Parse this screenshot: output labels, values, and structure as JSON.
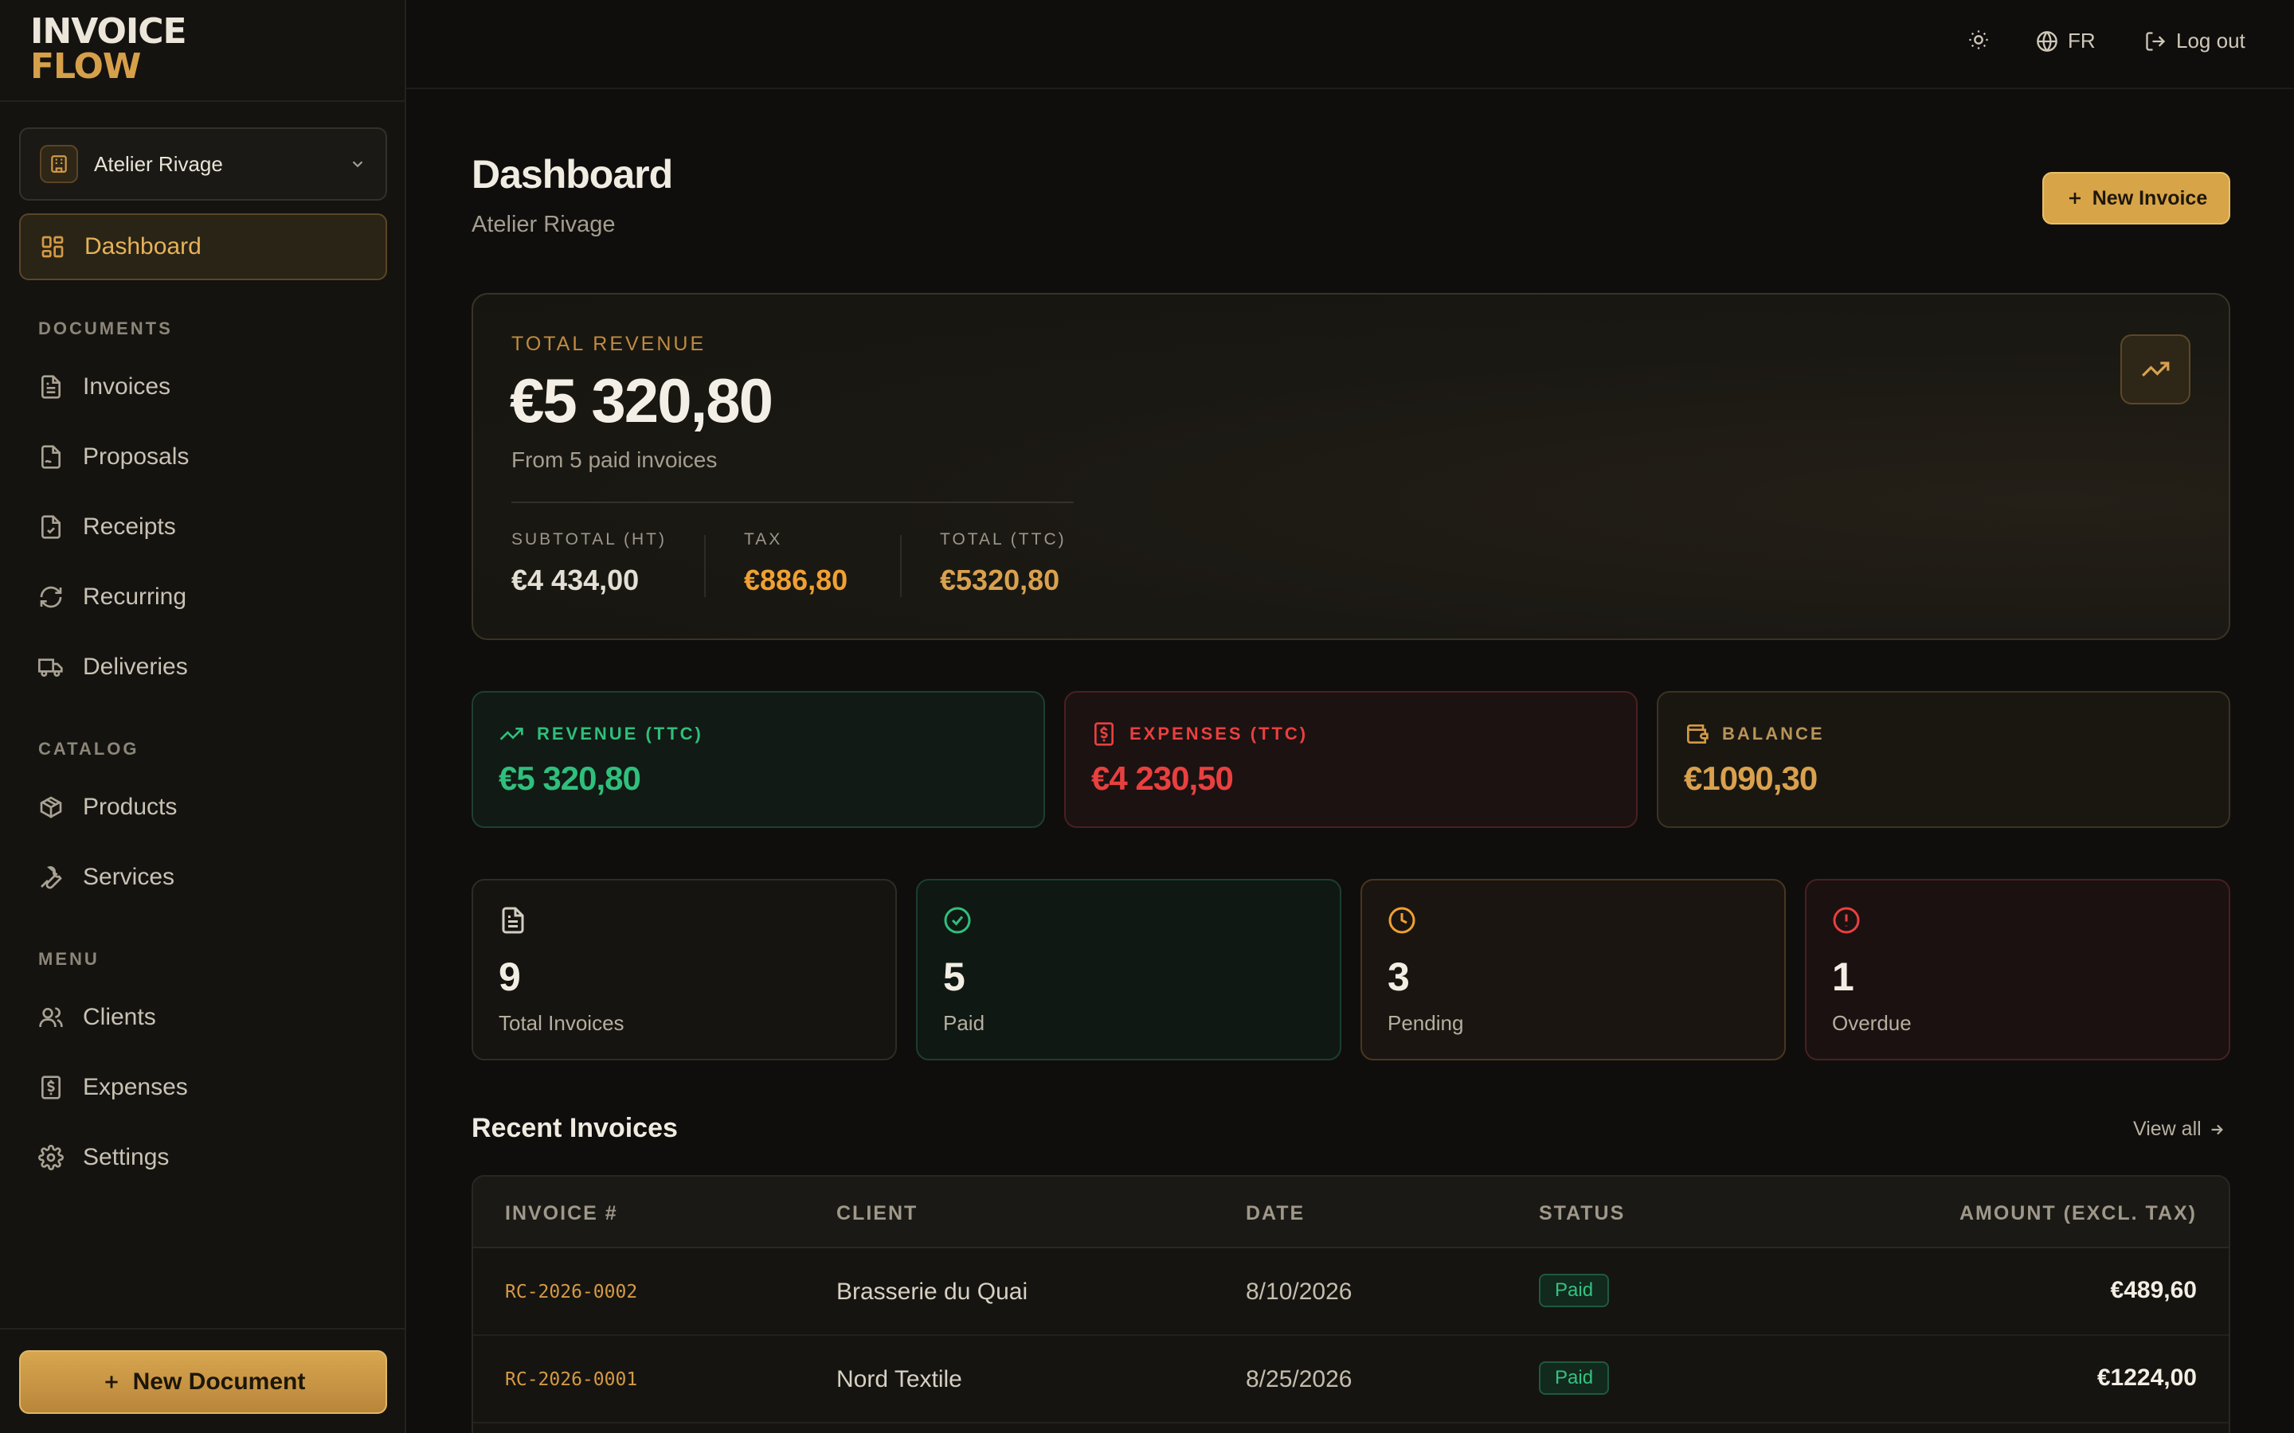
{
  "brand": {
    "line1": "INVOICE",
    "line2": "FLOW"
  },
  "organization": {
    "name": "Atelier Rivage"
  },
  "sidebar": {
    "dashboard": "Dashboard",
    "sections": [
      {
        "heading": "DOCUMENTS",
        "items": [
          "Invoices",
          "Proposals",
          "Receipts",
          "Recurring",
          "Deliveries"
        ]
      },
      {
        "heading": "CATALOG",
        "items": [
          "Products",
          "Services"
        ]
      },
      {
        "heading": "MENU",
        "items": [
          "Clients",
          "Expenses",
          "Settings"
        ]
      }
    ],
    "new_document": "New Document"
  },
  "topbar": {
    "language": "FR",
    "logout": "Log out"
  },
  "header": {
    "title": "Dashboard",
    "subtitle": "Atelier Rivage",
    "new_invoice": "New Invoice"
  },
  "hero": {
    "label": "TOTAL REVENUE",
    "amount": "€5 320,80",
    "from": "From 5 paid invoices",
    "subtotal_label": "SUBTOTAL (HT)",
    "subtotal": "€4 434,00",
    "tax_label": "TAX",
    "tax": "€886,80",
    "total_label": "TOTAL (TTC)",
    "total": "€5320,80"
  },
  "summary": {
    "revenue_label": "REVENUE (TTC)",
    "revenue": "€5 320,80",
    "expenses_label": "EXPENSES (TTC)",
    "expenses": "€4 230,50",
    "balance_label": "BALANCE",
    "balance": "€1090,30"
  },
  "stats": {
    "total": "9",
    "total_label": "Total Invoices",
    "paid": "5",
    "paid_label": "Paid",
    "pending": "3",
    "pending_label": "Pending",
    "overdue": "1",
    "overdue_label": "Overdue"
  },
  "recent": {
    "title": "Recent Invoices",
    "view_all": "View all",
    "columns": [
      "INVOICE #",
      "CLIENT",
      "DATE",
      "STATUS",
      "AMOUNT (EXCL. TAX)"
    ],
    "rows": [
      {
        "number": "RC-2026-0002",
        "client": "Brasserie du Quai",
        "date": "8/10/2026",
        "status": "Paid",
        "amount": "€489,60"
      },
      {
        "number": "RC-2026-0001",
        "client": "Nord Textile",
        "date": "8/25/2026",
        "status": "Paid",
        "amount": "€1224,00"
      }
    ]
  },
  "colors": {
    "accent": "#d7a448",
    "green": "#2fbf7c",
    "red": "#e8403f",
    "orange": "#f0a032"
  }
}
